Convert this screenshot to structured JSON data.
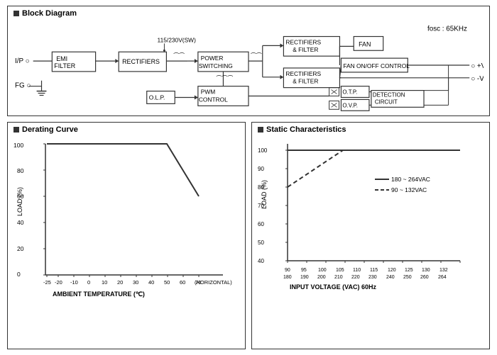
{
  "blockDiagram": {
    "title": "Block Diagram",
    "fosc": "fosc : 65KHz",
    "voltage": "115/230V(SW)",
    "components": [
      "EMI FILTER",
      "RECTIFIERS",
      "POWER SWITCHING",
      "PWM CONTROL",
      "O.L.P.",
      "FAN",
      "FAN ON/OFF CONTROL",
      "O.T.P.",
      "O.V.P.",
      "DETECTION CIRCUIT"
    ],
    "labels": {
      "ip": "I/P",
      "fg": "FG",
      "plusV": "+V",
      "minusV": "-V",
      "rectifiersFilter1": "RECTIFIERS & FILTER",
      "rectifiersFilter2": "RECTIFIERS & FILTER"
    }
  },
  "deratingCurve": {
    "title": "Derating Curve",
    "xLabel": "AMBIENT TEMPERATURE (℃)",
    "yLabel": "LOAD (%)",
    "xAxisLabel": "HORIZONTAL",
    "xTicks": [
      "-25",
      "-20",
      "-10",
      "0",
      "10",
      "20",
      "30",
      "40",
      "50",
      "60",
      "70"
    ],
    "yTicks": [
      "0",
      "20",
      "40",
      "60",
      "80",
      "100"
    ]
  },
  "staticCharacteristics": {
    "title": "Static Characteristics",
    "xLabel": "INPUT VOLTAGE (VAC) 60Hz",
    "yLabel": "LOAD (%)",
    "xTicksTop": [
      "90",
      "95",
      "100",
      "105",
      "110",
      "115",
      "120",
      "125",
      "130",
      "132"
    ],
    "xTicksBottom": [
      "180",
      "190",
      "200",
      "210",
      "220",
      "230",
      "240",
      "250",
      "260",
      "264"
    ],
    "yTicks": [
      "40",
      "50",
      "60",
      "70",
      "80",
      "90",
      "100"
    ],
    "legend": {
      "solid": "180 ~ 264VAC",
      "dashed": "90 ~ 132VAC"
    }
  }
}
